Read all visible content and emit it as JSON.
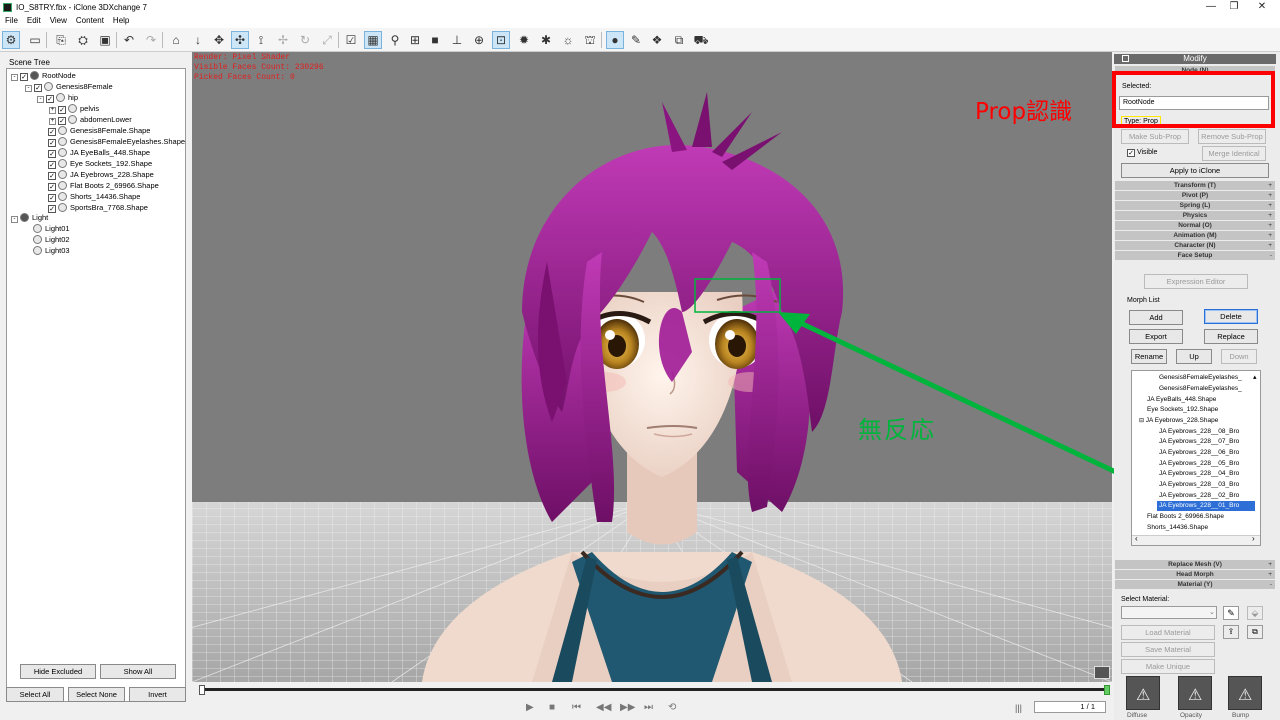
{
  "window": {
    "title": "IO_S8TRY.fbx - iClone 3DXchange 7",
    "min": "—",
    "max": "❐",
    "close": "✕"
  },
  "menu": [
    "File",
    "Edit",
    "View",
    "Content",
    "Help"
  ],
  "scene_tree": {
    "title": "Scene Tree",
    "items": [
      {
        "label": "RootNode"
      },
      {
        "label": "Genesis8Female"
      },
      {
        "label": "hip"
      },
      {
        "label": "pelvis"
      },
      {
        "label": "abdomenLower"
      },
      {
        "label": "Genesis8Female.Shape"
      },
      {
        "label": "Genesis8FemaleEyelashes.Shape"
      },
      {
        "label": "JA EyeBalls_448.Shape"
      },
      {
        "label": "Eye Sockets_192.Shape"
      },
      {
        "label": "JA Eyebrows_228.Shape"
      },
      {
        "label": "Flat Boots 2_69966.Shape"
      },
      {
        "label": "Shorts_14436.Shape"
      },
      {
        "label": "SportsBra_7768.Shape"
      },
      {
        "label": "Light"
      },
      {
        "label": "Light01"
      },
      {
        "label": "Light02"
      },
      {
        "label": "Light03"
      }
    ],
    "buttons": {
      "hide_excluded": "Hide Excluded",
      "show_all": "Show All",
      "select_all": "Select All",
      "select_none": "Select None",
      "invert": "Invert"
    }
  },
  "viewport": {
    "render": "Render: Pixel Shader",
    "visible_faces": "Visible Faces Count: 230296",
    "picked_faces": "Picked Faces Count: 0"
  },
  "timeline": {
    "frame": "1 / 1"
  },
  "modify": {
    "title": "Modify",
    "node_bar": "Node (N)",
    "selected_label": "Selected:",
    "selected_value": "RootNode",
    "type_label": "Type:",
    "type_value": "Prop",
    "make_sub_prop": "Make Sub-Prop",
    "remove_sub_prop": "Remove Sub-Prop",
    "visible": "Visible",
    "merge_identical": "Merge Identical",
    "apply": "Apply to iClone",
    "sections": [
      "Transform (T)",
      "Pivot (P)",
      "Spring (L)",
      "Physics",
      "Normal (O)",
      "Animation (M)",
      "Character (N)",
      "Face Setup"
    ],
    "expression_editor": "Expression Editor",
    "morph_list_label": "Morph List",
    "add": "Add",
    "delete": "Delete",
    "export": "Export",
    "replace": "Replace",
    "rename": "Rename",
    "up": "Up",
    "down": "Down",
    "morph_items": [
      "Genesis8FemaleEyelashes_",
      "Genesis8FemaleEyelashes_",
      "JA EyeBalls_448.Shape",
      "Eye Sockets_192.Shape",
      "JA Eyebrows_228.Shape",
      "JA Eyebrows_228__08_Bro",
      "JA Eyebrows_228__07_Bro",
      "JA Eyebrows_228__06_Bro",
      "JA Eyebrows_228__05_Bro",
      "JA Eyebrows_228__04_Bro",
      "JA Eyebrows_228__03_Bro",
      "JA Eyebrows_228__02_Bro",
      "JA Eyebrows_228__01_Bro",
      "Flat Boots 2_69966.Shape",
      "Shorts_14436.Shape"
    ],
    "lower_sections": [
      "Replace Mesh (V)",
      "Head Morph",
      "Material (Y)"
    ],
    "select_material": "Select Material:",
    "load_material": "Load Material",
    "save_material": "Save Material",
    "make_unique": "Make Unique",
    "thumbs": [
      "Diffuse",
      "Opacity",
      "Bump"
    ]
  },
  "annotations": {
    "prop": "Prop認識",
    "no_response": "無反応"
  },
  "colors": {
    "annot_red": "#ff0000",
    "annot_green": "#00b43c",
    "type_highlight": "#ffe600",
    "hair": "#9b1a8a"
  }
}
